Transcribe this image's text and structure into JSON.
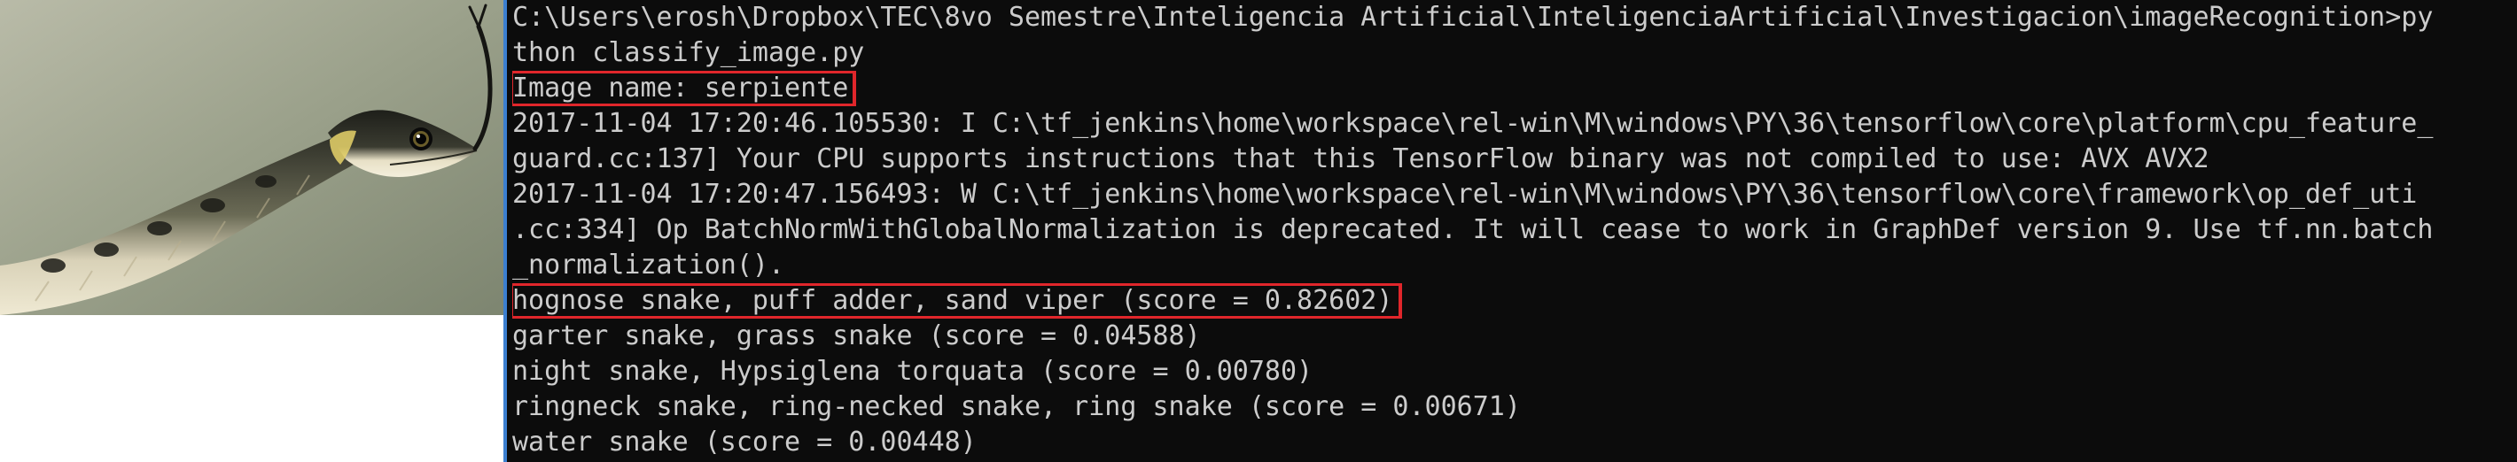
{
  "console": {
    "lines": [
      {
        "text": "C:\\Users\\erosh\\Dropbox\\TEC\\8vo Semestre\\Inteligencia Artificial\\InteligenciaArtificial\\Investigacion\\imageRecognition>py"
      },
      {
        "text": "thon classify_image.py"
      },
      {
        "text": "Image name: serpiente"
      },
      {
        "text": "2017-11-04 17:20:46.105530: I C:\\tf_jenkins\\home\\workspace\\rel-win\\M\\windows\\PY\\36\\tensorflow\\core\\platform\\cpu_feature_"
      },
      {
        "text": "guard.cc:137] Your CPU supports instructions that this TensorFlow binary was not compiled to use: AVX AVX2"
      },
      {
        "text": "2017-11-04 17:20:47.156493: W C:\\tf_jenkins\\home\\workspace\\rel-win\\M\\windows\\PY\\36\\tensorflow\\core\\framework\\op_def_uti"
      },
      {
        "text": ".cc:334] Op BatchNormWithGlobalNormalization is deprecated. It will cease to work in GraphDef version 9. Use tf.nn.batch"
      },
      {
        "text": "_normalization()."
      },
      {
        "text": "hognose snake, puff adder, sand viper (score = 0.82602)"
      },
      {
        "text": "garter snake, grass snake (score = 0.04588)"
      },
      {
        "text": "night snake, Hypsiglena torquata (score = 0.00780)"
      },
      {
        "text": "ringneck snake, ring-necked snake, ring snake (score = 0.00671)"
      },
      {
        "text": "water snake (score = 0.00448)"
      }
    ],
    "highlight_color": "#e0262b",
    "text_color": "#cccccc",
    "background": "#0c0c0c"
  },
  "photo": {
    "subject_icon": "snake-photo",
    "background_color": "#9aa08a"
  }
}
